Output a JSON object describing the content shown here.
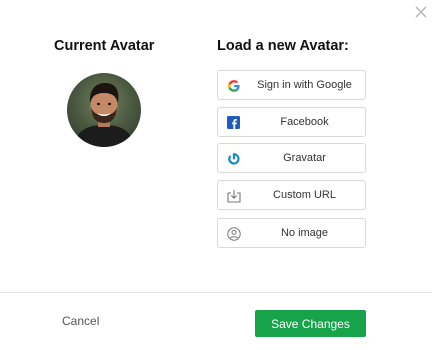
{
  "dialog": {
    "close_icon": "close-icon",
    "current_avatar": {
      "title": "Current Avatar",
      "image": "avatar-photo"
    },
    "load_avatar": {
      "title": "Load a new Avatar:",
      "options": [
        {
          "label": "Sign in with Google",
          "icon": "google-icon"
        },
        {
          "label": "Facebook",
          "icon": "facebook-icon"
        },
        {
          "label": "Gravatar",
          "icon": "gravatar-icon"
        },
        {
          "label": "Custom URL",
          "icon": "download-icon"
        },
        {
          "label": "No image",
          "icon": "user-icon"
        }
      ]
    },
    "footer": {
      "cancel_label": "Cancel",
      "save_label": "Save Changes"
    }
  },
  "colors": {
    "save_button": "#16a34a",
    "facebook": "#1877f2",
    "gravatar": "#1e8cbe"
  }
}
